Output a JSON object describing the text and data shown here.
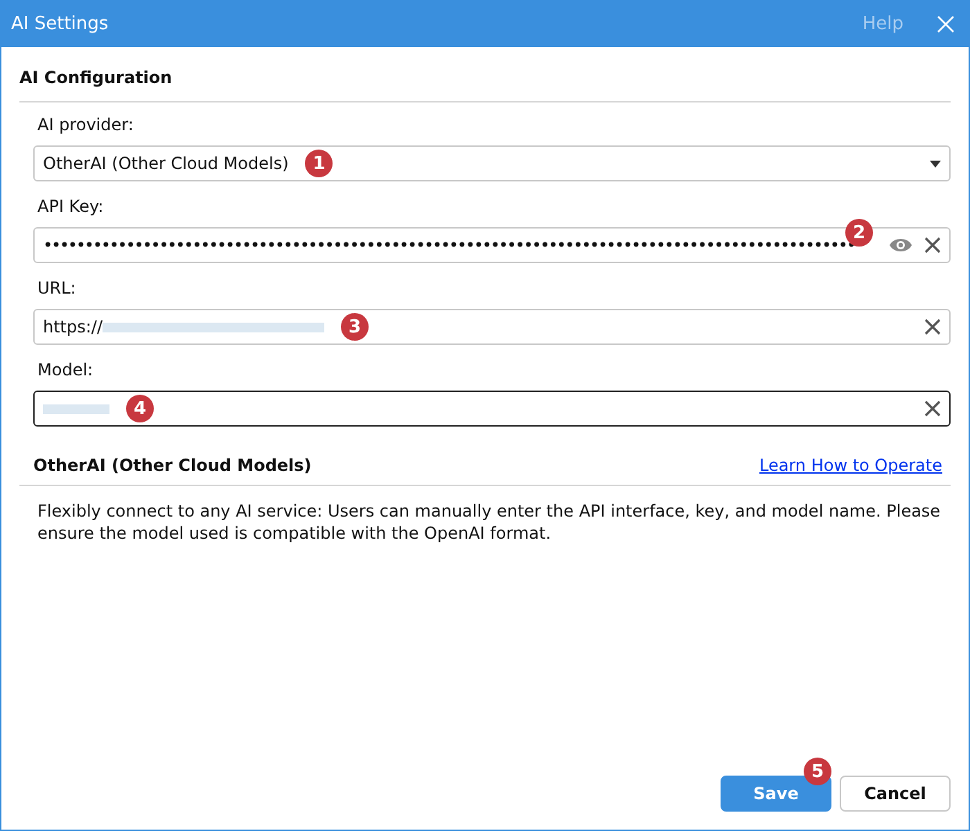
{
  "window": {
    "title": "AI Settings",
    "help": "Help"
  },
  "section_title": "AI Configuration",
  "fields": [
    {
      "kind": "select",
      "label": "AI provider:",
      "value": "OtherAI (Other Cloud Models)",
      "badge": "1",
      "focused": false
    },
    {
      "kind": "secret",
      "label": "API Key:",
      "value": "••••••••••••••••••••••••••••••••••••••••••••••••••••••••••••••••••••••••••••••••••••••••••••••••••",
      "badge": "2",
      "focused": false
    },
    {
      "kind": "text",
      "label": "URL:",
      "value": "https://",
      "redacted": true,
      "badge": "3",
      "focused": false
    },
    {
      "kind": "text",
      "label": "Model:",
      "redacted": true,
      "badge": "4",
      "focused": true
    }
  ],
  "provider": {
    "name": "OtherAI (Other Cloud Models)",
    "link": "Learn How to Operate",
    "description": "Flexibly connect to any AI service: Users can manually enter the API interface, key, and model name. Please ensure the model used is compatible with the OpenAI format."
  },
  "buttons": [
    {
      "kind": "primary",
      "label": "Save",
      "badge": "5"
    },
    {
      "kind": "secondary",
      "label": "Cancel"
    }
  ]
}
